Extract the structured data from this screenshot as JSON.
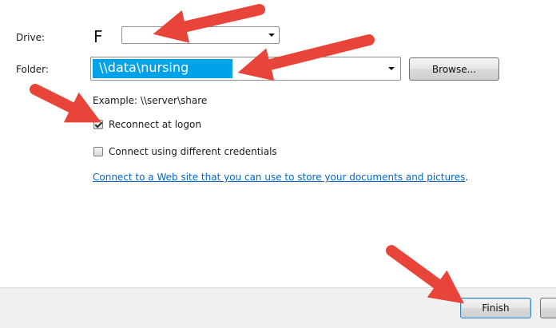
{
  "drive": {
    "label": "Drive:",
    "value": "F"
  },
  "folder": {
    "label": "Folder:",
    "value": "\\\\data\\nursing",
    "highlight_color": "#00a2e8"
  },
  "browse_label": "Browse...",
  "example_text": "Example: \\\\server\\share",
  "reconnect": {
    "label": "Reconnect at logon",
    "checked": true
  },
  "credentials": {
    "label": "Connect using different credentials",
    "checked": false
  },
  "web_link": {
    "text": "Connect to a Web site that you can use to store your documents and pictures",
    "trail": ".",
    "color": "#0066cc"
  },
  "finish_label": "Finish",
  "annotation_color": "#e8443a",
  "icons": [
    "dropdown-arrow-icon",
    "checkbox-checked-icon",
    "red-arrow-annotation"
  ]
}
